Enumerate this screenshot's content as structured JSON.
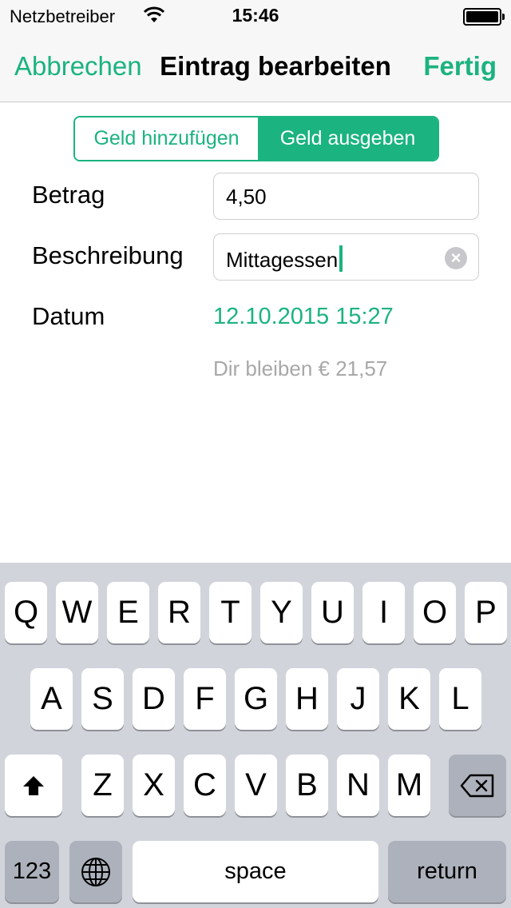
{
  "status_bar": {
    "carrier": "Netzbetreiber",
    "time": "15:46"
  },
  "nav": {
    "cancel_label": "Abbrechen",
    "title": "Eintrag bearbeiten",
    "done_label": "Fertig"
  },
  "segment": {
    "left_label": "Geld hinzufügen",
    "right_label": "Geld ausgeben",
    "selected": "right"
  },
  "form": {
    "amount_label": "Betrag",
    "amount_value": "4,50",
    "description_label": "Beschreibung",
    "description_value": "Mittagessen",
    "date_label": "Datum",
    "date_value": "12.10.2015 15:27",
    "remaining_text": "Dir bleiben € 21,57"
  },
  "keyboard": {
    "row1": [
      "Q",
      "W",
      "E",
      "R",
      "T",
      "Y",
      "U",
      "I",
      "O",
      "P"
    ],
    "row2": [
      "A",
      "S",
      "D",
      "F",
      "G",
      "H",
      "J",
      "K",
      "L"
    ],
    "row3": [
      "Z",
      "X",
      "C",
      "V",
      "B",
      "N",
      "M"
    ],
    "numbers_label": "123",
    "space_label": "space",
    "return_label": "return",
    "shift_icon": "shift-icon",
    "delete_icon": "backspace-icon",
    "globe_icon": "globe-icon"
  },
  "colors": {
    "accent": "#1bb380",
    "keyboard_bg": "#d1d4db",
    "key_dark": "#acb1bb"
  }
}
